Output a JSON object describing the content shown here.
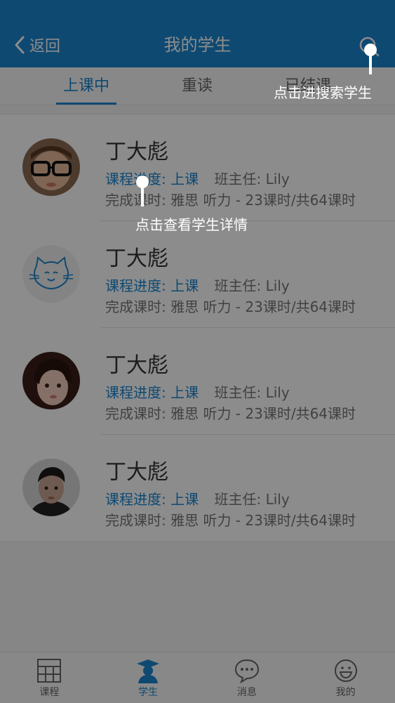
{
  "header": {
    "back_label": "返回",
    "title": "我的学生"
  },
  "tabs": [
    {
      "label": "上课中"
    },
    {
      "label": "重读"
    },
    {
      "label": "已结课"
    }
  ],
  "students": [
    {
      "name": "丁大彪",
      "progress_label": "课程进度:",
      "progress_value": "上课",
      "teacher": "班主任: Lily",
      "hours": "完成课时: 雅思 听力 - 23课时/共64课时"
    },
    {
      "name": "丁大彪",
      "progress_label": "课程进度:",
      "progress_value": "上课",
      "teacher": "班主任: Lily",
      "hours": "完成课时: 雅思 听力 - 23课时/共64课时"
    },
    {
      "name": "丁大彪",
      "progress_label": "课程进度:",
      "progress_value": "上课",
      "teacher": "班主任: Lily",
      "hours": "完成课时: 雅思 听力 - 23课时/共64课时"
    },
    {
      "name": "丁大彪",
      "progress_label": "课程进度:",
      "progress_value": "上课",
      "teacher": "班主任: Lily",
      "hours": "完成课时: 雅思 听力 - 23课时/共64课时"
    }
  ],
  "tabbar": [
    {
      "label": "课程",
      "icon": "calendar-icon"
    },
    {
      "label": "学生",
      "icon": "student-icon"
    },
    {
      "label": "消息",
      "icon": "message-icon"
    },
    {
      "label": "我的",
      "icon": "smiley-icon"
    }
  ],
  "hints": {
    "search_hint": "点击进搜索学生",
    "detail_hint": "点击查看学生详情"
  },
  "colors": {
    "accent": "#1a86d0",
    "overlay": "rgba(0,0,0,0.45)"
  }
}
